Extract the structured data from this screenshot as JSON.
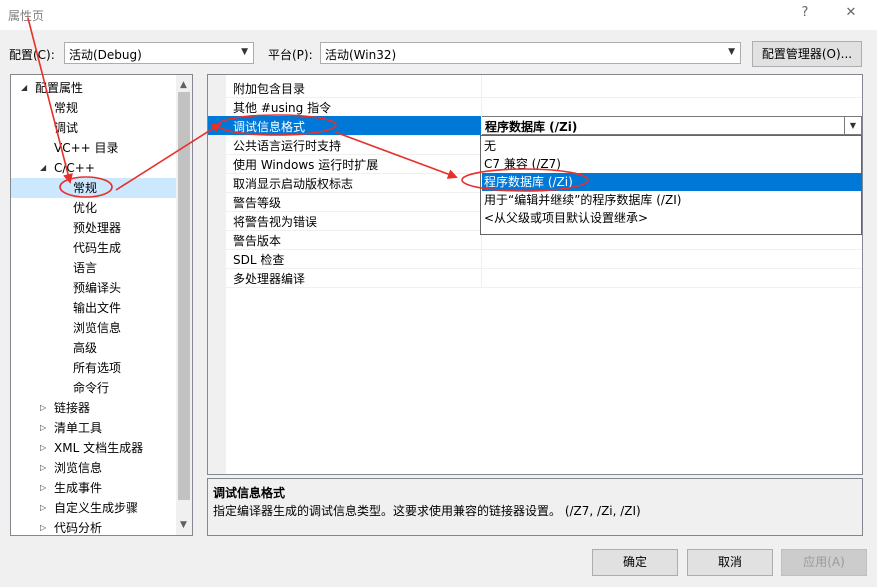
{
  "window": {
    "title": "属性页",
    "help_glyph": "?",
    "close_glyph": "✕"
  },
  "config": {
    "config_label": "配置(C):",
    "config_value": "活动(Debug)",
    "platform_label": "平台(P):",
    "platform_value": "活动(Win32)",
    "manager_button": "配置管理器(O)..."
  },
  "tree": {
    "items": [
      {
        "label": "配置属性",
        "expander": "◢"
      },
      {
        "label": "常规"
      },
      {
        "label": "调试"
      },
      {
        "label": "VC++ 目录"
      },
      {
        "label": "C/C++",
        "expander": "◢"
      },
      {
        "label": "常规"
      },
      {
        "label": "优化"
      },
      {
        "label": "预处理器"
      },
      {
        "label": "代码生成"
      },
      {
        "label": "语言"
      },
      {
        "label": "预编译头"
      },
      {
        "label": "输出文件"
      },
      {
        "label": "浏览信息"
      },
      {
        "label": "高级"
      },
      {
        "label": "所有选项"
      },
      {
        "label": "命令行"
      },
      {
        "label": "链接器",
        "expander": "▷"
      },
      {
        "label": "清单工具",
        "expander": "▷"
      },
      {
        "label": "XML 文档生成器",
        "expander": "▷"
      },
      {
        "label": "浏览信息",
        "expander": "▷"
      },
      {
        "label": "生成事件",
        "expander": "▷"
      },
      {
        "label": "自定义生成步骤",
        "expander": "▷"
      },
      {
        "label": "代码分析",
        "expander": "▷"
      }
    ]
  },
  "properties": {
    "rows": [
      {
        "name": "附加包含目录",
        "value": ""
      },
      {
        "name": "其他 #using 指令",
        "value": ""
      },
      {
        "name": "调试信息格式",
        "value": "程序数据库 (/Zi)"
      },
      {
        "name": "公共语言运行时支持",
        "value": ""
      },
      {
        "name": "使用 Windows 运行时扩展",
        "value": ""
      },
      {
        "name": "取消显示启动版权标志",
        "value": ""
      },
      {
        "name": "警告等级",
        "value": ""
      },
      {
        "name": "将警告视为错误",
        "value": ""
      },
      {
        "name": "警告版本",
        "value": ""
      },
      {
        "name": "SDL 检查",
        "value": ""
      },
      {
        "name": "多处理器编译",
        "value": ""
      }
    ]
  },
  "dropdown": {
    "options": [
      "无",
      "C7 兼容 (/Z7)",
      "程序数据库 (/Zi)",
      "用于“编辑并继续”的程序数据库 (/ZI)",
      "<从父级或项目默认设置继承>"
    ]
  },
  "description": {
    "title": "调试信息格式",
    "text": "指定编译器生成的调试信息类型。这要求使用兼容的链接器设置。   (/Z7, /Zi, /ZI)"
  },
  "buttons": {
    "ok": "确定",
    "cancel": "取消",
    "apply": "应用(A)"
  },
  "annotation_color": "#e8302a"
}
